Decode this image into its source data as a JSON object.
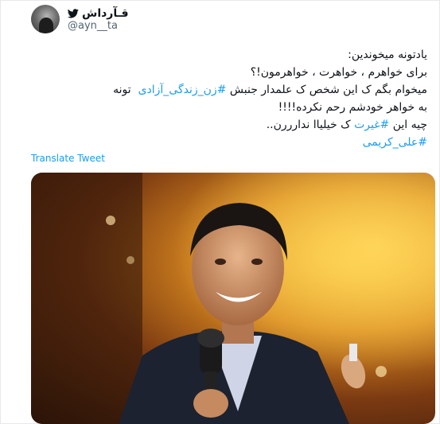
{
  "author": {
    "display_name": "قـآرداش",
    "handle": "@ayn__ta"
  },
  "tweet": {
    "lines": [
      "یادتونه میخوندین:",
      "برای خواهرم ، خواهرت ، خواهرمون!؟",
      "میخوام بگم ک این شخص ک علمدار جنبش",
      "#زن_زندگی_آزادی",
      "تونه",
      "به خواهر خودشم رحم نکرده!!!!",
      "چیه این",
      "#غیرت",
      "ک خیلیاا ندارررن..",
      "#علی_کریمی"
    ]
  },
  "translate_label": "Translate Tweet",
  "icons": {
    "verified": "twitter-bird-icon"
  },
  "colors": {
    "link": "#1d9bf0",
    "text": "#0f1419",
    "secondary": "#536471"
  },
  "media": {
    "description_icon": "photo"
  }
}
